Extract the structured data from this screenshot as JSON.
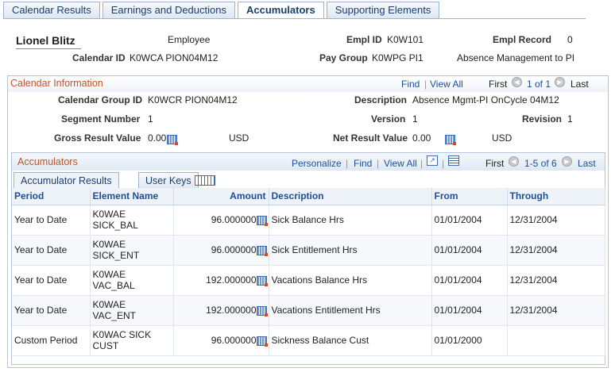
{
  "tabs": [
    "Calendar Results",
    "Earnings and Deductions",
    "Accumulators",
    "Supporting Elements"
  ],
  "active_tab": "Accumulators",
  "header": {
    "name": "Lionel Blitz",
    "employee_label": "Employee",
    "empl_id_label": "Empl ID",
    "empl_id": "K0W101",
    "empl_record_label": "Empl Record",
    "empl_record": "0",
    "calendar_id_label": "Calendar ID",
    "calendar_id": "K0WCA PION04M12",
    "pay_group_label": "Pay Group",
    "pay_group": "K0WPG PI1",
    "pay_group_desc": "Absence Management to PI"
  },
  "calendar_info": {
    "title": "Calendar Information",
    "find": "Find",
    "view_all": "View All",
    "first": "First",
    "range": "1 of 1",
    "last": "Last",
    "calendar_group_id_label": "Calendar Group ID",
    "calendar_group_id": "K0WCR PION04M12",
    "description_label": "Description",
    "description": "Absence Mgmt-PI OnCycle 04M12",
    "segment_number_label": "Segment Number",
    "segment_number": "1",
    "version_label": "Version",
    "version": "1",
    "revision_label": "Revision",
    "revision": "1",
    "gross_result_label": "Gross Result Value",
    "gross_result": "0.00",
    "gross_currency": "USD",
    "net_result_label": "Net Result Value",
    "net_result": "0.00",
    "net_currency": "USD"
  },
  "accumulators": {
    "title": "Accumulators",
    "personalize": "Personalize",
    "find": "Find",
    "view_all": "View All",
    "first": "First",
    "range": "1-5 of 6",
    "last": "Last",
    "tabs": [
      "Accumulator Results",
      "User Keys"
    ],
    "columns": [
      "Period",
      "Element Name",
      "Amount",
      "Description",
      "From",
      "Through"
    ],
    "rows": [
      {
        "period": "Year to Date",
        "element": "K0WAE SICK_BAL",
        "amount": "96.000000",
        "description": "Sick Balance Hrs",
        "from": "01/01/2004",
        "through": "12/31/2004"
      },
      {
        "period": "Year to Date",
        "element": "K0WAE SICK_ENT",
        "amount": "96.000000",
        "description": "Sick Entitlement Hrs",
        "from": "01/01/2004",
        "through": "12/31/2004"
      },
      {
        "period": "Year to Date",
        "element": "K0WAE VAC_BAL",
        "amount": "192.000000",
        "description": "Vacations Balance Hrs",
        "from": "01/01/2004",
        "through": "12/31/2004"
      },
      {
        "period": "Year to Date",
        "element": "K0WAE VAC_ENT",
        "amount": "192.000000",
        "description": "Vacations Entitlement Hrs",
        "from": "01/01/2004",
        "through": "12/31/2004"
      },
      {
        "period": "Custom Period",
        "element": "K0WAC SICK CUST",
        "amount": "96.000000",
        "description": "Sickness Balance Cust",
        "from": "01/01/2000",
        "through": ""
      }
    ]
  }
}
